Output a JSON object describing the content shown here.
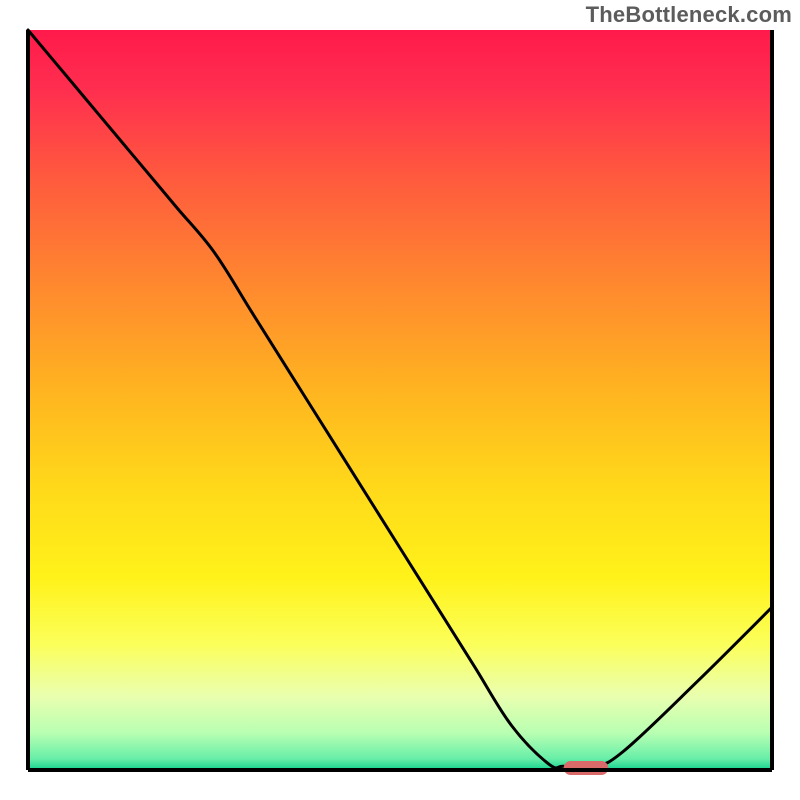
{
  "watermark": "TheBottleneck.com",
  "chart_data": {
    "type": "line",
    "title": "",
    "xlabel": "",
    "ylabel": "",
    "xlim": [
      0,
      100
    ],
    "ylim": [
      0,
      100
    ],
    "x": [
      0,
      5,
      10,
      15,
      20,
      25,
      30,
      35,
      40,
      45,
      50,
      55,
      60,
      65,
      70,
      72,
      76,
      80,
      90,
      100
    ],
    "values": [
      100,
      94,
      88,
      82,
      76,
      70,
      62,
      54,
      46,
      38,
      30,
      22,
      14,
      6,
      0.8,
      0.5,
      0.5,
      2.5,
      12,
      22
    ],
    "marker": {
      "x_start": 72,
      "x_end": 78,
      "y": 0,
      "color": "#da6a6a"
    },
    "borders": {
      "top": false,
      "right": true,
      "bottom": true,
      "left": true,
      "color": "#000000",
      "width": 4
    }
  }
}
